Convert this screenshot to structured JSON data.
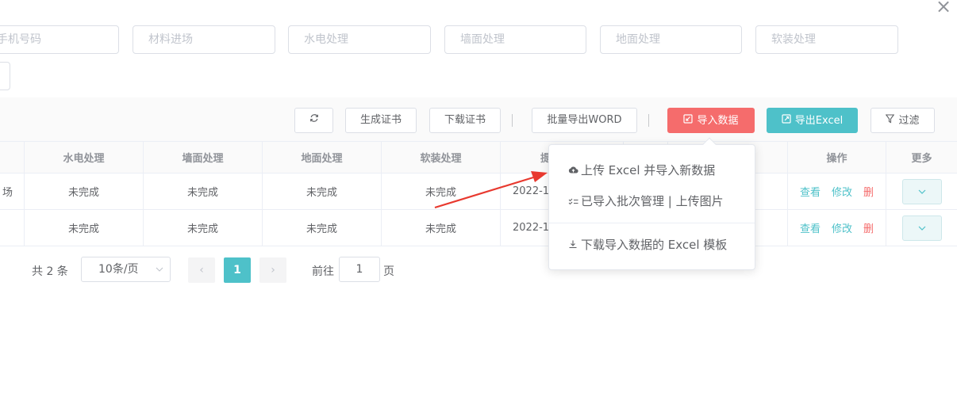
{
  "dialog": {
    "close_icon": "close-icon"
  },
  "filters": {
    "phone_placeholder": "手机号码",
    "material_placeholder": "材料进场",
    "plumbing_placeholder": "水电处理",
    "wall_placeholder": "墙面处理",
    "floor_placeholder": "地面处理",
    "soft_placeholder": "软装处理"
  },
  "toolbar": {
    "refresh_icon": "refresh-icon",
    "generate_cert": "生成证书",
    "download_cert": "下载证书",
    "batch_export_word": "批量导出WORD",
    "import_data": "导入数据",
    "export_excel": "导出Excel",
    "filter": "过滤"
  },
  "table": {
    "headers": {
      "first_col": "",
      "plumbing": "水电处理",
      "wall": "墙面处理",
      "floor": "地面处理",
      "soft": "软装处理",
      "submit_partial": "提",
      "actions": "操作",
      "more": "更多"
    },
    "rows": [
      {
        "first_col": "场",
        "plumbing": "未完成",
        "wall": "未完成",
        "floor": "未完成",
        "soft": "未完成",
        "date_partial": "2022-11",
        "view": "查看",
        "edit": "修改",
        "delete": "删"
      },
      {
        "first_col": "",
        "plumbing": "未完成",
        "wall": "未完成",
        "floor": "未完成",
        "soft": "未完成",
        "date_partial": "2022-11",
        "view": "查看",
        "edit": "修改",
        "delete": "删"
      }
    ]
  },
  "pagination": {
    "total": "共 2 条",
    "page_size": "10条/页",
    "prev": "‹",
    "current_page": "1",
    "next": "›",
    "goto_label": "前往",
    "goto_value": "1",
    "page_unit": "页"
  },
  "dropdown": {
    "upload_import": "上传 Excel 并导入新数据",
    "batch_manage": "已导入批次管理 | 上传图片",
    "download_template": "下载导入数据的 Excel 模板"
  },
  "colors": {
    "primary": "#4ec1c9",
    "danger": "#f56c6c",
    "arrow": "#e8392f"
  }
}
